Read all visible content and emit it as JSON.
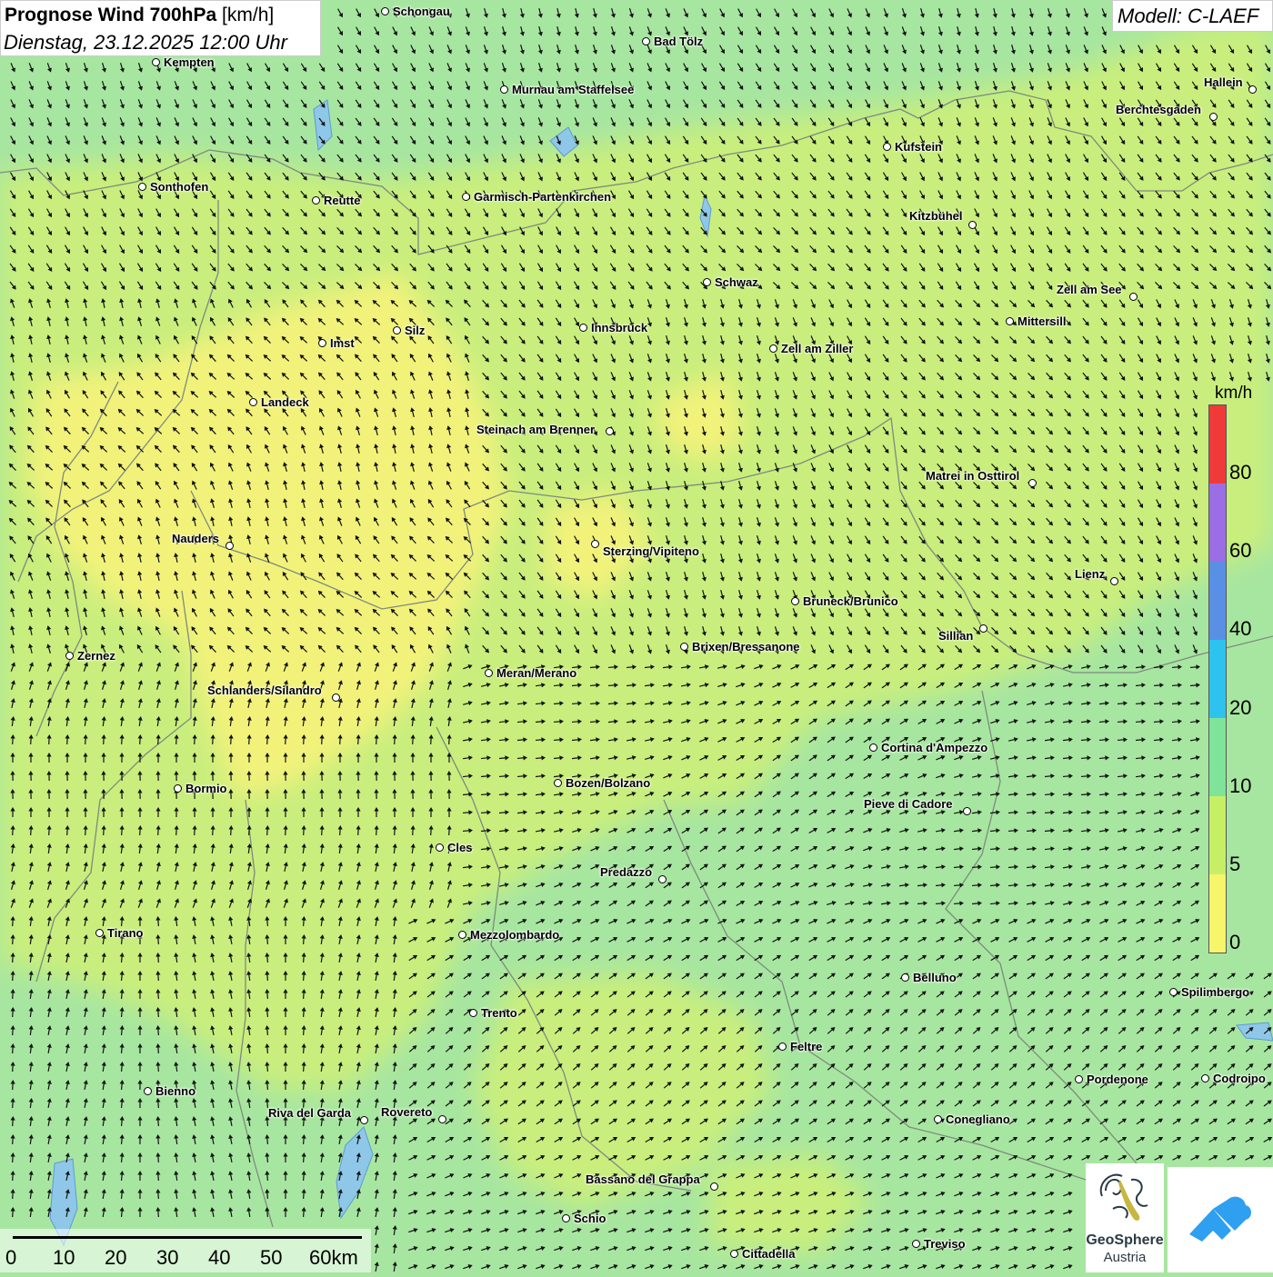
{
  "title": {
    "main_bold": "Prognose Wind 700hPa",
    "main_unit": "[km/h]",
    "date": "Dienstag, 23.12.2025 12:00 Uhr"
  },
  "model": "Modell: C-LAEF",
  "legend": {
    "unit": "km/h",
    "ticks": [
      "80",
      "60",
      "40",
      "20",
      "10",
      "5",
      "0"
    ],
    "colors": [
      "#f03a3a",
      "#9b6ee6",
      "#5a8fe6",
      "#2ec3ef",
      "#7fe49a",
      "#c7ef66",
      "#f7f56a"
    ]
  },
  "scale": {
    "labels": [
      "0",
      "10",
      "20",
      "30",
      "40",
      "50",
      "60km"
    ]
  },
  "logo": {
    "name": "GeoSphere",
    "sub": "Austria"
  },
  "colors": {
    "calm_yellow": "#f2f27a",
    "light_green": "#c9ee7d",
    "green": "#a7e6a0",
    "brand_blue": "#2f9ff0"
  },
  "cities": [
    {
      "name": "Schongau"
    },
    {
      "name": "Bad Tölz"
    },
    {
      "name": "Kempten"
    },
    {
      "name": "Murnau am Staffelsee"
    },
    {
      "name": "Hallein"
    },
    {
      "name": "Berchtesgaden"
    },
    {
      "name": "Kufstein"
    },
    {
      "name": "Sonthofen"
    },
    {
      "name": "Reutte"
    },
    {
      "name": "Garmisch-Partenkirchen"
    },
    {
      "name": "Kitzbühel"
    },
    {
      "name": "Schwaz"
    },
    {
      "name": "Zell am See"
    },
    {
      "name": "Silz"
    },
    {
      "name": "Innsbruck"
    },
    {
      "name": "Mittersill"
    },
    {
      "name": "Imst"
    },
    {
      "name": "Zell am Ziller"
    },
    {
      "name": "Landeck"
    },
    {
      "name": "Steinach am Brenner"
    },
    {
      "name": "Matrei in Osttirol"
    },
    {
      "name": "Nauders"
    },
    {
      "name": "Sterzing/Vipiteno"
    },
    {
      "name": "Lienz"
    },
    {
      "name": "Bruneck/Brunico"
    },
    {
      "name": "Sillian"
    },
    {
      "name": "Brixen/Bressanone"
    },
    {
      "name": "Zernez"
    },
    {
      "name": "Meran/Merano"
    },
    {
      "name": "Schlanders/Silandro"
    },
    {
      "name": "Cortina d'Ampezzo"
    },
    {
      "name": "Bozen/Bolzano"
    },
    {
      "name": "Bormio"
    },
    {
      "name": "Pieve di Cadore"
    },
    {
      "name": "Cles"
    },
    {
      "name": "Predazzo"
    },
    {
      "name": "Tirano"
    },
    {
      "name": "Mezzolombardo"
    },
    {
      "name": "Belluno"
    },
    {
      "name": "Spilimbergo"
    },
    {
      "name": "Trento"
    },
    {
      "name": "Feltre"
    },
    {
      "name": "Pordenone"
    },
    {
      "name": "Codroipo"
    },
    {
      "name": "Bienno"
    },
    {
      "name": "Riva del Garda"
    },
    {
      "name": "Rovereto"
    },
    {
      "name": "Conegliano"
    },
    {
      "name": "Bassano del Grappa"
    },
    {
      "name": "Schio"
    },
    {
      "name": "Treviso"
    },
    {
      "name": "Cittadella"
    }
  ]
}
